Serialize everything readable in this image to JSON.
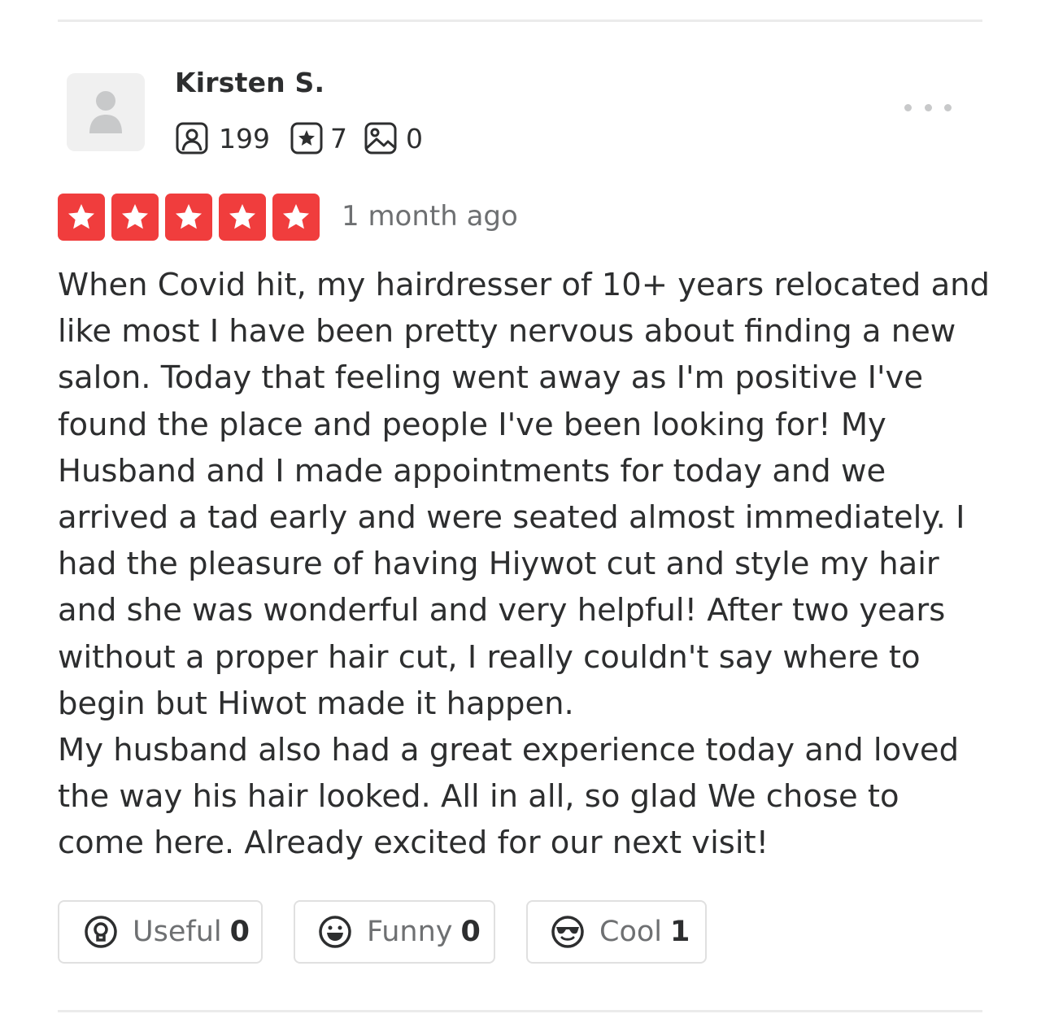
{
  "reviewer": {
    "name": "Kirsten S.",
    "stats": {
      "friends": "199",
      "reviews": "7",
      "photos": "0"
    }
  },
  "review": {
    "rating": 5,
    "time_ago": "1 month ago",
    "text_paragraph_1": "When Covid hit, my hairdresser of 10+ years relocated and like most I have been pretty nervous about finding a new salon. Today that feeling went away as I'm positive I've found the place and people I've been looking for! My Husband and I made appointments for today and we arrived a tad early and were seated almost immediately. I had the pleasure of having Hiywot cut and style my hair and she was wonderful and very helpful! After two years without a proper hair cut, I really couldn't say where to begin but Hiwot made it happen.",
    "text_paragraph_2": "My husband also had a great experience today and loved the way his hair looked. All in all, so glad We chose to come here. Already excited for our next visit!"
  },
  "reactions": {
    "useful": {
      "label": "Useful",
      "count": "0"
    },
    "funny": {
      "label": "Funny",
      "count": "0"
    },
    "cool": {
      "label": "Cool",
      "count": "1"
    }
  },
  "colors": {
    "star_red": "#f03d3d",
    "text": "#2d2e2f",
    "muted": "#6e7072",
    "border": "#e0e0e0"
  },
  "icons": {
    "avatar": "default-user-avatar-icon",
    "friends": "friends-icon",
    "reviews": "reviews-star-icon",
    "photos": "photos-icon",
    "more": "more-options-icon",
    "useful": "lightbulb-icon",
    "funny": "smiley-icon",
    "cool": "sunglasses-icon"
  }
}
